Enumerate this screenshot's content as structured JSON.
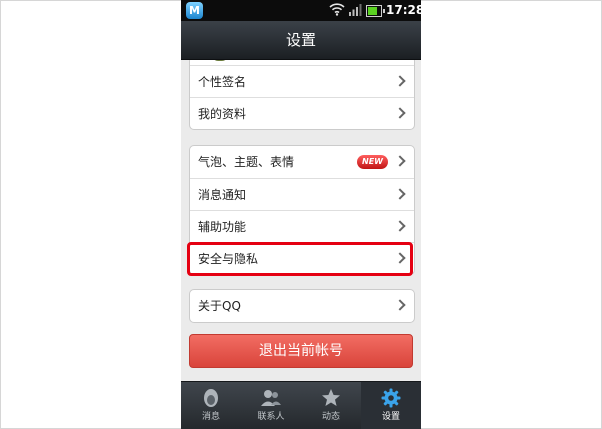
{
  "status_bar": {
    "time": "17:28",
    "app_icon_letter": "M"
  },
  "header": {
    "title": "设置"
  },
  "groups": [
    {
      "items": [
        {
          "label": "个性签名"
        },
        {
          "label": "我的资料"
        }
      ]
    },
    {
      "items": [
        {
          "label": "气泡、主题、表情",
          "badge": "NEW"
        },
        {
          "label": "消息通知"
        },
        {
          "label": "辅助功能"
        },
        {
          "label": "安全与隐私",
          "highlighted": true
        }
      ]
    },
    {
      "items": [
        {
          "label": "关于QQ"
        }
      ]
    }
  ],
  "logout_button": {
    "label": "退出当前帐号"
  },
  "tabs": [
    {
      "label": "消息",
      "icon": "penguin-icon"
    },
    {
      "label": "联系人",
      "icon": "contacts-icon"
    },
    {
      "label": "动态",
      "icon": "star-icon"
    },
    {
      "label": "设置",
      "icon": "gear-icon",
      "active": true
    }
  ],
  "colors": {
    "highlight": "#e50012",
    "logout": "#e8564d",
    "badge": "#e02020",
    "title_bar": "#262b30"
  }
}
